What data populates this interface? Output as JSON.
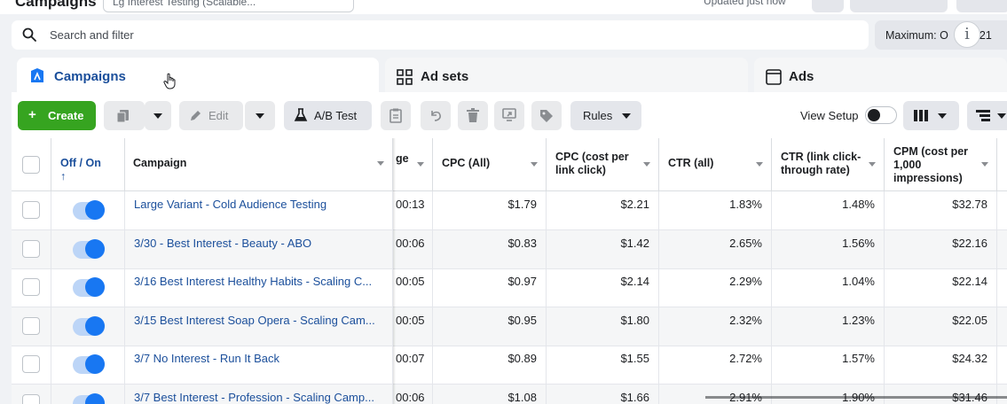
{
  "top": {
    "title": "Campaigns",
    "select_text": "Lg Interest Testing (Scalable...",
    "updated_text": "Updated just now"
  },
  "search": {
    "placeholder": "Search and filter"
  },
  "date_range": {
    "label": "Maximum: Oct 2021",
    "label_left": "Maximum: O",
    "label_right": "2021"
  },
  "tabs": [
    {
      "label": "Campaigns",
      "icon": "campaigns-icon",
      "active": true
    },
    {
      "label": "Ad sets",
      "icon": "grid-icon",
      "active": false
    },
    {
      "label": "Ads",
      "icon": "ad-window-icon",
      "active": false
    }
  ],
  "toolbar": {
    "create_label": "Create",
    "edit_label": "Edit",
    "ab_test_label": "A/B Test",
    "rules_label": "Rules",
    "view_setup_label": "View Setup"
  },
  "table": {
    "headers": {
      "onoff": "Off / On ↑",
      "campaign": "Campaign",
      "partial": "ge",
      "cpc_all": "CPC (All)",
      "cpc_link": "CPC (cost per link click)",
      "ctr_all": "CTR (all)",
      "ctr_link": "CTR (link click-through rate)",
      "cpm": "CPM (cost per 1,000 impressions)"
    },
    "rows": [
      {
        "campaign": "Large Variant - Cold Audience Testing",
        "partial": "00:13",
        "cpc_all": "$1.79",
        "cpc_link": "$2.21",
        "ctr_all": "1.83%",
        "ctr_link": "1.48%",
        "cpm": "$32.78"
      },
      {
        "campaign": "3/30 - Best Interest - Beauty - ABO",
        "partial": "00:06",
        "cpc_all": "$0.83",
        "cpc_link": "$1.42",
        "ctr_all": "2.65%",
        "ctr_link": "1.56%",
        "cpm": "$22.16"
      },
      {
        "campaign": "3/16 Best Interest Healthy Habits - Scaling C...",
        "partial": "00:05",
        "cpc_all": "$0.97",
        "cpc_link": "$2.14",
        "ctr_all": "2.29%",
        "ctr_link": "1.04%",
        "cpm": "$22.14"
      },
      {
        "campaign": "3/15 Best Interest Soap Opera - Scaling Cam...",
        "partial": "00:05",
        "cpc_all": "$0.95",
        "cpc_link": "$1.80",
        "ctr_all": "2.32%",
        "ctr_link": "1.23%",
        "cpm": "$22.05"
      },
      {
        "campaign": "3/7 No Interest - Run It Back",
        "partial": "00:07",
        "cpc_all": "$0.89",
        "cpc_link": "$1.55",
        "ctr_all": "2.72%",
        "ctr_link": "1.57%",
        "cpm": "$24.32"
      },
      {
        "campaign": "3/7 Best Interest - Profession - Scaling Camp...",
        "partial": "00:06",
        "cpc_all": "$1.08",
        "cpc_link": "$1.66",
        "ctr_all": "2.91%",
        "ctr_link": "1.90%",
        "cpm": "$31.46"
      }
    ]
  },
  "colors": {
    "accent": "#1877f2",
    "create_green": "#36a420",
    "link": "#1b4f9b"
  }
}
